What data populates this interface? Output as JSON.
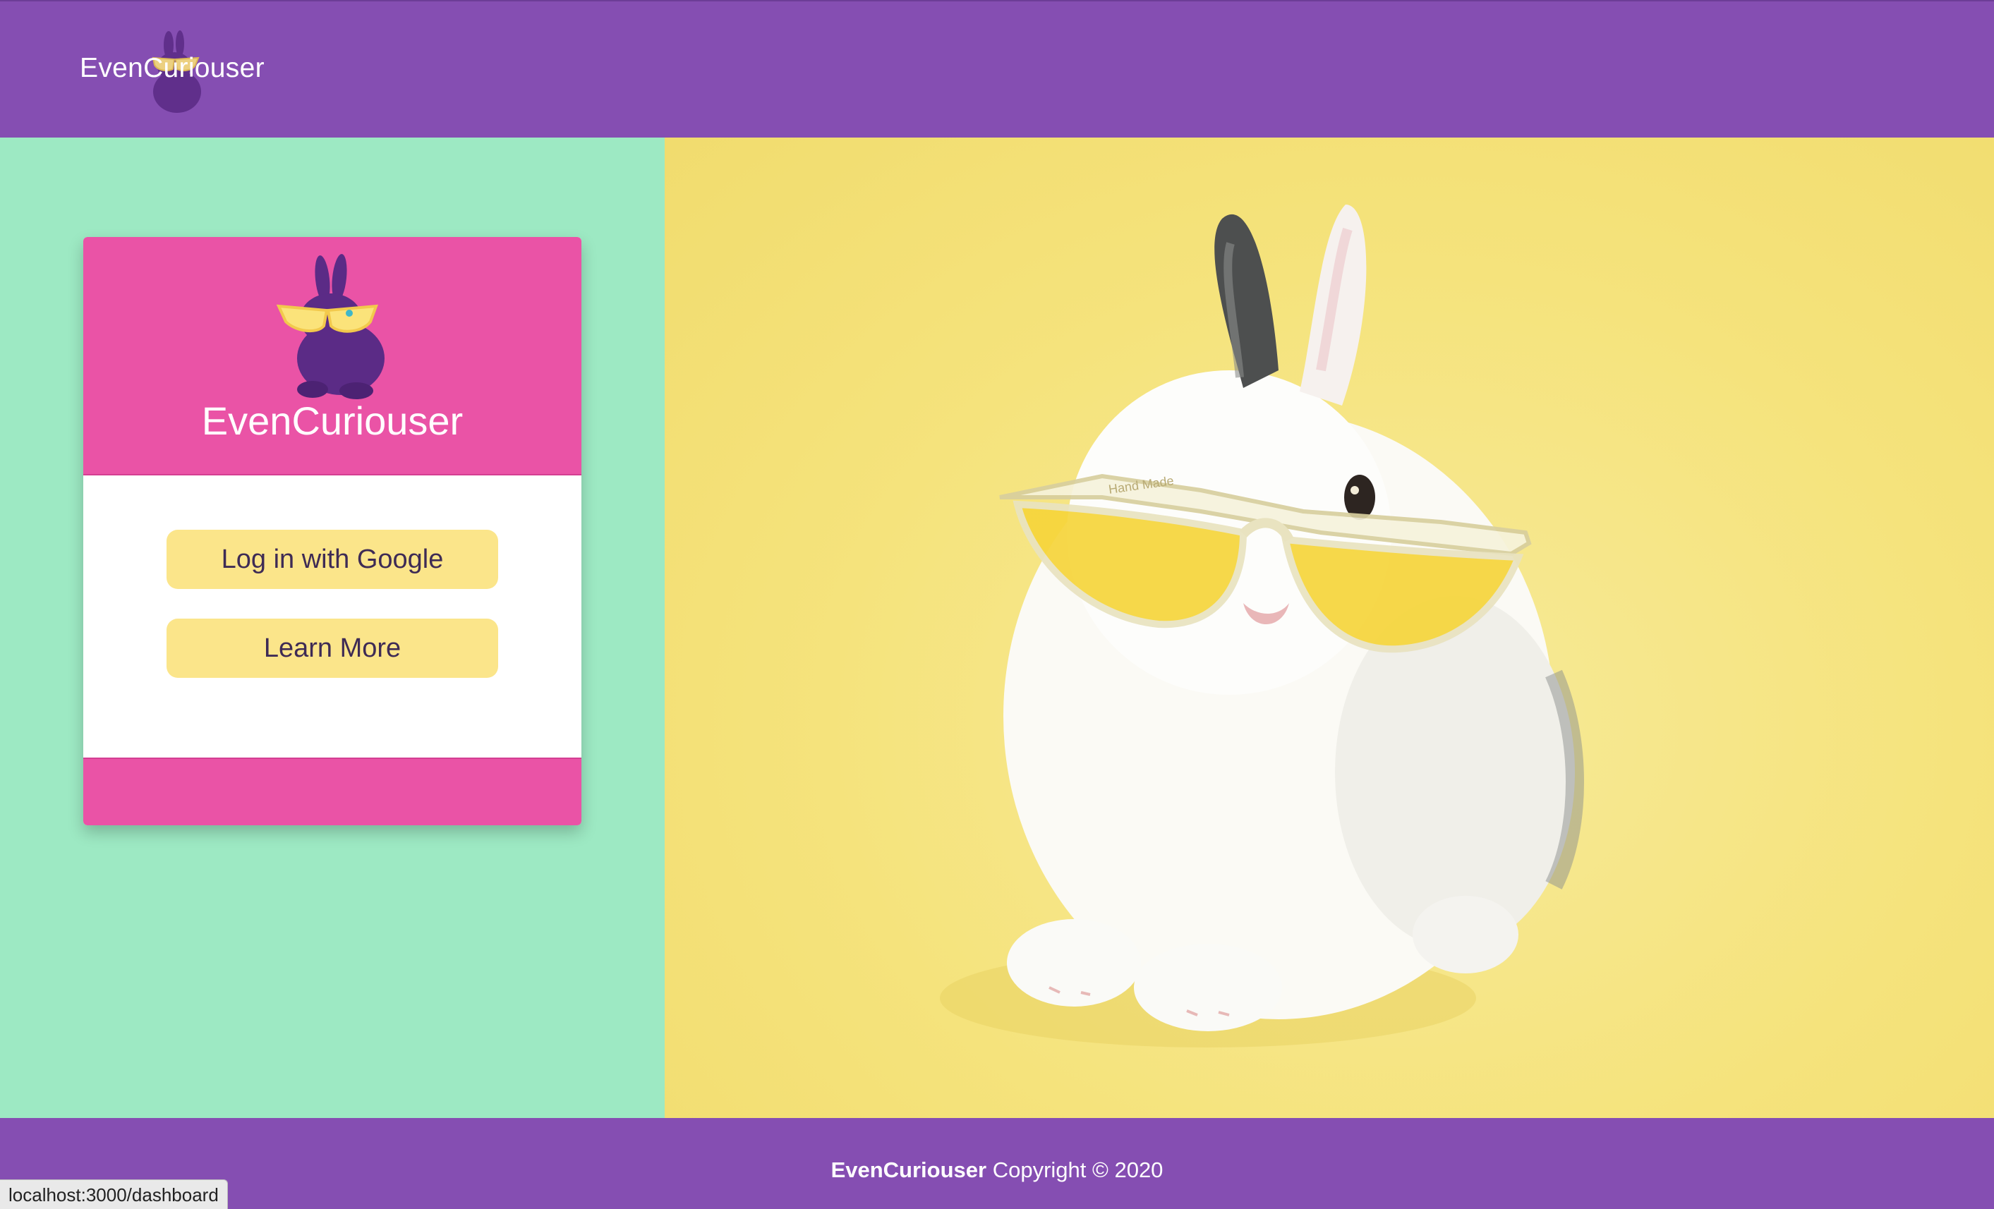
{
  "header": {
    "brand": "EvenCuriouser",
    "logo_icon": "rabbit-sunglasses-logo"
  },
  "card": {
    "logo_icon": "rabbit-sunglasses-logo",
    "title": "EvenCuriouser",
    "buttons": {
      "google": "Log in with Google",
      "learn_more": "Learn More"
    }
  },
  "hero": {
    "subject": "rabbit-with-yellow-sunglasses-photo",
    "frame_text": "Hand Made"
  },
  "footer": {
    "brand": "EvenCuriouser",
    "copyright": "Copyright © 2020"
  },
  "status_bar": {
    "url": "localhost:3000/dashboard"
  },
  "colors": {
    "header": "#854eb2",
    "left_panel": "#9de9c3",
    "card_accent": "#ea53a6",
    "button": "#fbe58a",
    "button_text": "#3e2b55",
    "hero_background": "#f5e37c"
  }
}
